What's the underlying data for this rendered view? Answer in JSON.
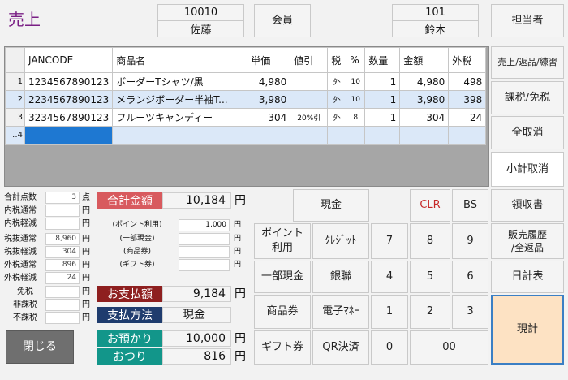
{
  "header": {
    "title": "売上",
    "customer": {
      "code": "10010",
      "name": "佐藤"
    },
    "member_label": "会員",
    "staff": {
      "code": "101",
      "name": "鈴木"
    },
    "staff_button": "担当者"
  },
  "table": {
    "columns": [
      "JANCODE",
      "商品名",
      "単価",
      "値引",
      "税",
      "%",
      "数量",
      "金額",
      "外税"
    ],
    "rows": [
      {
        "no": "1",
        "jan": "1234567890123",
        "name": "ボーダーTシャツ/黒",
        "price": "4,980",
        "discount": "",
        "tax": "外",
        "rate": "10",
        "qty": "1",
        "amount": "4,980",
        "outtax": "498"
      },
      {
        "no": "2",
        "jan": "2234567890123",
        "name": "メランジボーダー半袖T...",
        "price": "3,980",
        "discount": "",
        "tax": "外",
        "rate": "10",
        "qty": "1",
        "amount": "3,980",
        "outtax": "398"
      },
      {
        "no": "3",
        "jan": "3234567890123",
        "name": "フルーツキャンディー",
        "price": "304",
        "discount": "20%引",
        "tax": "外",
        "rate": "8",
        "qty": "1",
        "amount": "304",
        "outtax": "24"
      }
    ],
    "new_row_no": "4",
    "new_row_marker": "‥"
  },
  "summary": [
    {
      "label": "合計点数",
      "value": "3",
      "unit": "点"
    },
    {
      "label": "内税通常",
      "value": "",
      "unit": "円"
    },
    {
      "label": "内税軽減",
      "value": "",
      "unit": "円"
    },
    {
      "label": "税抜通常",
      "value": "8,960",
      "unit": "円"
    },
    {
      "label": "税抜軽減",
      "value": "304",
      "unit": "円"
    },
    {
      "label": "外税通常",
      "value": "896",
      "unit": "円"
    },
    {
      "label": "外税軽減",
      "value": "24",
      "unit": "円"
    },
    {
      "label": "免税",
      "value": "",
      "unit": "円"
    },
    {
      "label": "非課税",
      "value": "",
      "unit": "円"
    },
    {
      "label": "不課税",
      "value": "",
      "unit": "円"
    }
  ],
  "payments_list": [
    {
      "label": "(ポイント利用)",
      "value": "1,000",
      "unit": "円"
    },
    {
      "label": "(一部現金)",
      "value": "",
      "unit": "円"
    },
    {
      "label": "(商品券)",
      "value": "",
      "unit": "円"
    },
    {
      "label": "(ギフト券)",
      "value": "",
      "unit": "円"
    }
  ],
  "totals": {
    "total_label": "合計金額",
    "total_value": "10,184",
    "pay_label": "お支払額",
    "pay_value": "9,184",
    "method_label": "支払方法",
    "method_value": "現金",
    "received_label": "お預かり",
    "received_value": "10,000",
    "change_label": "おつり",
    "change_value": "816",
    "unit": "円"
  },
  "close_button": "閉じる",
  "pay_buttons": {
    "cash": "現金",
    "point_line1": "ポイント",
    "point_line2": "利用",
    "partial_cash": "一部現金",
    "voucher": "商品券",
    "gift": "ギフト券",
    "credit": "ｸﾚｼﾞｯﾄ",
    "union": "銀聯",
    "emoney": "電子ﾏﾈｰ",
    "qr": "QR決済"
  },
  "keypad": {
    "clr": "CLR",
    "bs": "BS",
    "k7": "7",
    "k8": "8",
    "k9": "9",
    "k4": "4",
    "k5": "5",
    "k6": "6",
    "k1": "1",
    "k2": "2",
    "k3": "3",
    "k0": "0",
    "k00": "00"
  },
  "side_buttons": {
    "sale_mode": "売上/返品/練習",
    "taxable": "課税/免税",
    "cancel_all": "全取消",
    "cancel_subtotal": "小計取消",
    "receipt": "領収書",
    "history_line1": "販売履歴",
    "history_line2": "/全返品",
    "daily_report": "日計表",
    "current_total": "現計"
  },
  "colors": {
    "title": "#7a1f85",
    "red_tag": "#d85a5e",
    "maroon_tag": "#8e1f1f",
    "navy_tag": "#1f3c6e",
    "teal_tag": "#12968a",
    "current_total_bg": "#fde2c3",
    "selection": "#1e78d2"
  }
}
